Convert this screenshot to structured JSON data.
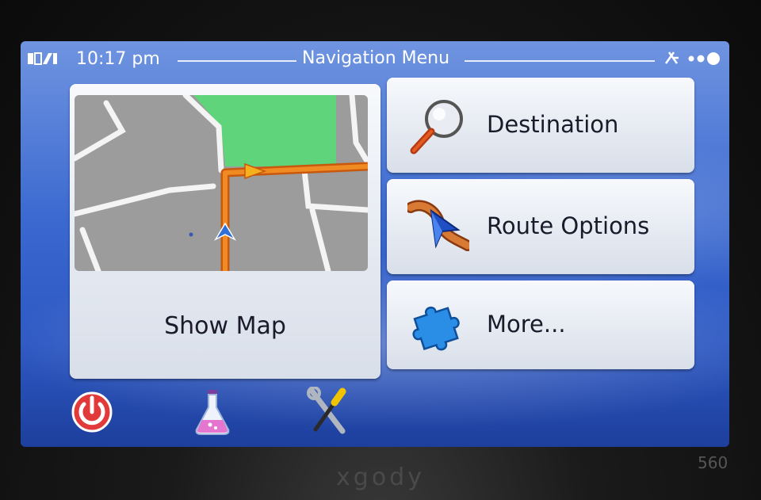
{
  "status": {
    "time": "10:17 pm",
    "title": "Navigation Menu",
    "signal_icon": "signal-strength-icon",
    "gps_icon": "gps-satellite-icon"
  },
  "map_panel": {
    "label": "Show Map"
  },
  "menu": [
    {
      "label": "Destination",
      "icon": "magnifier-icon"
    },
    {
      "label": "Route Options",
      "icon": "route-options-icon"
    },
    {
      "label": "More...",
      "icon": "puzzle-icon"
    }
  ],
  "bottom_bar": {
    "power_icon": "power-icon",
    "flask_icon": "flask-icon",
    "tools_icon": "tools-icon"
  },
  "device": {
    "brand": "xgody",
    "model": "560"
  },
  "colors": {
    "screen_blue": "#3a68cf",
    "route_orange": "#e07a1a",
    "park_green": "#5fd47a"
  }
}
